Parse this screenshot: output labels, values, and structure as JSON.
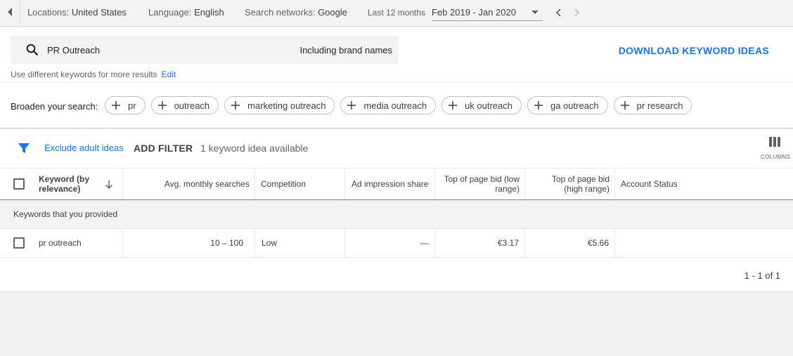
{
  "topbar": {
    "locations_label": "Locations:",
    "locations_value": "United States",
    "language_label": "Language:",
    "language_value": "English",
    "networks_label": "Search networks:",
    "networks_value": "Google",
    "period_label": "Last 12 months",
    "period_value": "Feb 2019 - Jan 2020"
  },
  "search": {
    "query": "PR Outreach",
    "brand_option": "Including brand names",
    "download_label": "DOWNLOAD KEYWORD IDEAS",
    "hint": "Use different keywords for more results",
    "edit_label": "Edit"
  },
  "broaden": {
    "label": "Broaden your search:",
    "chips": [
      "pr",
      "outreach",
      "marketing outreach",
      "media outreach",
      "uk outreach",
      "ga outreach",
      "pr research"
    ]
  },
  "filters": {
    "exclude_label": "Exclude adult ideas",
    "add_filter_label": "ADD FILTER",
    "available_text": "1 keyword idea available",
    "columns_label": "COLUMNS"
  },
  "table": {
    "headers": {
      "keyword": "Keyword (by relevance)",
      "searches": "Avg. monthly searches",
      "competition": "Competition",
      "impression": "Ad impression share",
      "bid_low": "Top of page bid (low range)",
      "bid_high": "Top of page bid (high range)",
      "status": "Account Status"
    },
    "group_label": "Keywords that you provided",
    "rows": [
      {
        "keyword": "pr outreach",
        "searches": "10 – 100",
        "competition": "Low",
        "impression": "—",
        "bid_low": "€3.17",
        "bid_high": "€5.66",
        "status": ""
      }
    ]
  },
  "pagination": {
    "text": "1 - 1 of 1"
  },
  "colors": {
    "accent": "#1a73e8",
    "text": "#3c4043",
    "muted": "#5f6368",
    "background": "#f1f1f1"
  }
}
